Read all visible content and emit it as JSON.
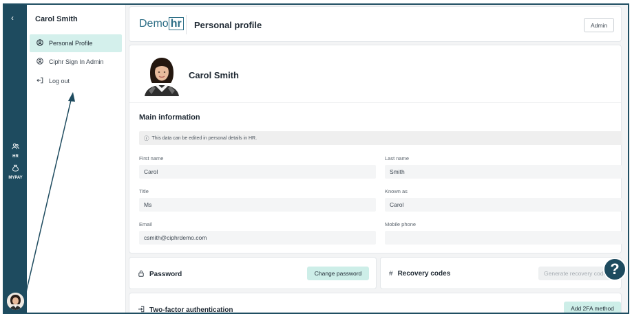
{
  "sidebar": {
    "user_name": "Carol Smith",
    "items": [
      {
        "label": "Personal Profile",
        "icon": "user-circle-icon",
        "active": true
      },
      {
        "label": "Ciphr Sign In Admin",
        "icon": "user-circle-icon",
        "active": false
      },
      {
        "label": "Log out",
        "icon": "logout-icon",
        "active": false
      }
    ]
  },
  "rail": {
    "items": [
      {
        "label": "HR",
        "icon": "people-icon"
      },
      {
        "label": "MYPAY",
        "icon": "money-bag-icon"
      }
    ]
  },
  "header": {
    "logo_prefix": "Demo",
    "logo_box": "hr",
    "title": "Personal profile",
    "role_button": "Admin"
  },
  "profile": {
    "name": "Carol Smith",
    "section_title": "Main information",
    "notice": "This data can be edited in personal details in HR.",
    "fields": {
      "first_name": {
        "label": "First name",
        "value": "Carol"
      },
      "last_name": {
        "label": "Last name",
        "value": "Smith"
      },
      "title": {
        "label": "Title",
        "value": "Ms"
      },
      "known_as": {
        "label": "Known as",
        "value": "Carol"
      },
      "email": {
        "label": "Email",
        "value": "csmith@ciphrdemo.com"
      },
      "mobile": {
        "label": "Mobile phone",
        "value": ""
      }
    }
  },
  "password": {
    "title": "Password",
    "button": "Change password"
  },
  "recovery": {
    "title": "Recovery codes",
    "button": "Generate recovery codes"
  },
  "two_factor": {
    "title": "Two-factor authentication",
    "button": "Add 2FA method"
  },
  "help": {
    "glyph": "?"
  },
  "colors": {
    "rail": "#1e4b5f",
    "accent": "#cdeee8",
    "brand": "#2d6e86"
  }
}
